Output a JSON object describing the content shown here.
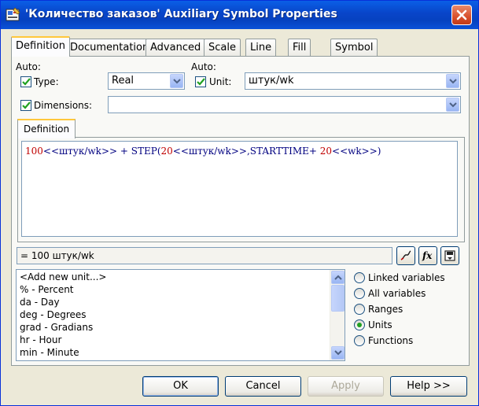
{
  "window": {
    "title": "'Количество заказов' Auxiliary Symbol Properties"
  },
  "tabs": [
    {
      "label": "Definition",
      "active": true
    },
    {
      "label": "Documentation"
    },
    {
      "label": "Advanced"
    },
    {
      "label": "Scale"
    },
    {
      "label": "Line"
    },
    {
      "label": "Fill"
    },
    {
      "label": "Symbol"
    }
  ],
  "auto_left_label": "Auto:",
  "auto_right_label": "Auto:",
  "type": {
    "label": "Type:",
    "checked": true,
    "value": "Real"
  },
  "unit": {
    "label": "Unit:",
    "checked": true,
    "value": "штук/wk"
  },
  "dimensions": {
    "label": "Dimensions:",
    "checked": true,
    "value": ""
  },
  "definition_tab": "Definition",
  "equation": {
    "segments": [
      {
        "text": "100",
        "kind": "num"
      },
      {
        "text": "<<штук/wk>>",
        "kind": "unit"
      },
      {
        "text": " + ",
        "kind": "op"
      },
      {
        "text": "STEP",
        "kind": "fn"
      },
      {
        "text": "(",
        "kind": "op"
      },
      {
        "text": "20",
        "kind": "num"
      },
      {
        "text": "<<штук/wk>>",
        "kind": "unit"
      },
      {
        "text": ",STARTTIME+ ",
        "kind": "fn"
      },
      {
        "text": "20",
        "kind": "num"
      },
      {
        "text": "<<wk>>",
        "kind": "unit"
      },
      {
        "text": ")",
        "kind": "op"
      }
    ]
  },
  "result": "= 100 штук/wk",
  "unit_list": [
    "<Add new unit...>",
    "% - Percent",
    "da - Day",
    "deg - Degrees",
    "grad - Gradians",
    "hr - Hour",
    "min - Minute"
  ],
  "radio_options": [
    {
      "label": "Linked variables",
      "selected": false
    },
    {
      "label": "All variables",
      "selected": false
    },
    {
      "label": "Ranges",
      "selected": false
    },
    {
      "label": "Units",
      "selected": true
    },
    {
      "label": "Functions",
      "selected": false
    }
  ],
  "buttons": {
    "ok": "OK",
    "cancel": "Cancel",
    "apply": "Apply",
    "help": "Help >>"
  }
}
